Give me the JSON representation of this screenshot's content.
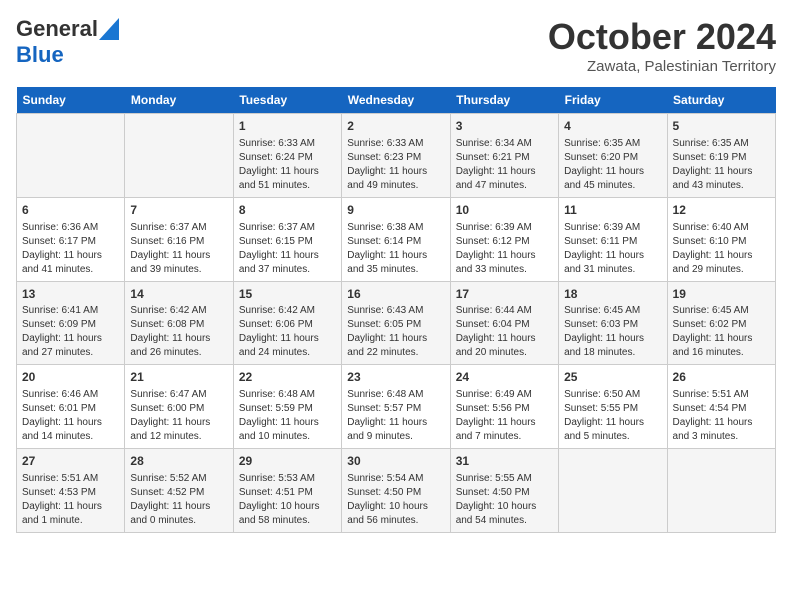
{
  "header": {
    "logo_general": "General",
    "logo_blue": "Blue",
    "month": "October 2024",
    "location": "Zawata, Palestinian Territory"
  },
  "days_of_week": [
    "Sunday",
    "Monday",
    "Tuesday",
    "Wednesday",
    "Thursday",
    "Friday",
    "Saturday"
  ],
  "weeks": [
    [
      {
        "day": "",
        "info": ""
      },
      {
        "day": "",
        "info": ""
      },
      {
        "day": "1",
        "info": "Sunrise: 6:33 AM\nSunset: 6:24 PM\nDaylight: 11 hours and 51 minutes."
      },
      {
        "day": "2",
        "info": "Sunrise: 6:33 AM\nSunset: 6:23 PM\nDaylight: 11 hours and 49 minutes."
      },
      {
        "day": "3",
        "info": "Sunrise: 6:34 AM\nSunset: 6:21 PM\nDaylight: 11 hours and 47 minutes."
      },
      {
        "day": "4",
        "info": "Sunrise: 6:35 AM\nSunset: 6:20 PM\nDaylight: 11 hours and 45 minutes."
      },
      {
        "day": "5",
        "info": "Sunrise: 6:35 AM\nSunset: 6:19 PM\nDaylight: 11 hours and 43 minutes."
      }
    ],
    [
      {
        "day": "6",
        "info": "Sunrise: 6:36 AM\nSunset: 6:17 PM\nDaylight: 11 hours and 41 minutes."
      },
      {
        "day": "7",
        "info": "Sunrise: 6:37 AM\nSunset: 6:16 PM\nDaylight: 11 hours and 39 minutes."
      },
      {
        "day": "8",
        "info": "Sunrise: 6:37 AM\nSunset: 6:15 PM\nDaylight: 11 hours and 37 minutes."
      },
      {
        "day": "9",
        "info": "Sunrise: 6:38 AM\nSunset: 6:14 PM\nDaylight: 11 hours and 35 minutes."
      },
      {
        "day": "10",
        "info": "Sunrise: 6:39 AM\nSunset: 6:12 PM\nDaylight: 11 hours and 33 minutes."
      },
      {
        "day": "11",
        "info": "Sunrise: 6:39 AM\nSunset: 6:11 PM\nDaylight: 11 hours and 31 minutes."
      },
      {
        "day": "12",
        "info": "Sunrise: 6:40 AM\nSunset: 6:10 PM\nDaylight: 11 hours and 29 minutes."
      }
    ],
    [
      {
        "day": "13",
        "info": "Sunrise: 6:41 AM\nSunset: 6:09 PM\nDaylight: 11 hours and 27 minutes."
      },
      {
        "day": "14",
        "info": "Sunrise: 6:42 AM\nSunset: 6:08 PM\nDaylight: 11 hours and 26 minutes."
      },
      {
        "day": "15",
        "info": "Sunrise: 6:42 AM\nSunset: 6:06 PM\nDaylight: 11 hours and 24 minutes."
      },
      {
        "day": "16",
        "info": "Sunrise: 6:43 AM\nSunset: 6:05 PM\nDaylight: 11 hours and 22 minutes."
      },
      {
        "day": "17",
        "info": "Sunrise: 6:44 AM\nSunset: 6:04 PM\nDaylight: 11 hours and 20 minutes."
      },
      {
        "day": "18",
        "info": "Sunrise: 6:45 AM\nSunset: 6:03 PM\nDaylight: 11 hours and 18 minutes."
      },
      {
        "day": "19",
        "info": "Sunrise: 6:45 AM\nSunset: 6:02 PM\nDaylight: 11 hours and 16 minutes."
      }
    ],
    [
      {
        "day": "20",
        "info": "Sunrise: 6:46 AM\nSunset: 6:01 PM\nDaylight: 11 hours and 14 minutes."
      },
      {
        "day": "21",
        "info": "Sunrise: 6:47 AM\nSunset: 6:00 PM\nDaylight: 11 hours and 12 minutes."
      },
      {
        "day": "22",
        "info": "Sunrise: 6:48 AM\nSunset: 5:59 PM\nDaylight: 11 hours and 10 minutes."
      },
      {
        "day": "23",
        "info": "Sunrise: 6:48 AM\nSunset: 5:57 PM\nDaylight: 11 hours and 9 minutes."
      },
      {
        "day": "24",
        "info": "Sunrise: 6:49 AM\nSunset: 5:56 PM\nDaylight: 11 hours and 7 minutes."
      },
      {
        "day": "25",
        "info": "Sunrise: 6:50 AM\nSunset: 5:55 PM\nDaylight: 11 hours and 5 minutes."
      },
      {
        "day": "26",
        "info": "Sunrise: 5:51 AM\nSunset: 4:54 PM\nDaylight: 11 hours and 3 minutes."
      }
    ],
    [
      {
        "day": "27",
        "info": "Sunrise: 5:51 AM\nSunset: 4:53 PM\nDaylight: 11 hours and 1 minute."
      },
      {
        "day": "28",
        "info": "Sunrise: 5:52 AM\nSunset: 4:52 PM\nDaylight: 11 hours and 0 minutes."
      },
      {
        "day": "29",
        "info": "Sunrise: 5:53 AM\nSunset: 4:51 PM\nDaylight: 10 hours and 58 minutes."
      },
      {
        "day": "30",
        "info": "Sunrise: 5:54 AM\nSunset: 4:50 PM\nDaylight: 10 hours and 56 minutes."
      },
      {
        "day": "31",
        "info": "Sunrise: 5:55 AM\nSunset: 4:50 PM\nDaylight: 10 hours and 54 minutes."
      },
      {
        "day": "",
        "info": ""
      },
      {
        "day": "",
        "info": ""
      }
    ]
  ]
}
